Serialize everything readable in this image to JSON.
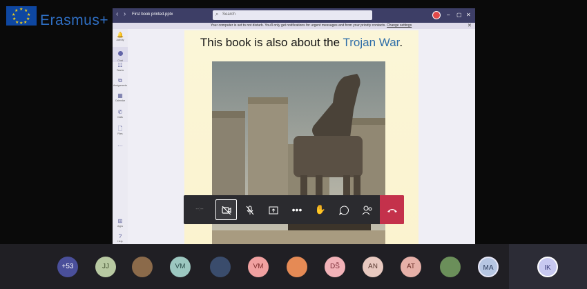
{
  "overlay": {
    "brand_text": "Erasmus+"
  },
  "window": {
    "title": "First book printed.pptx",
    "nav_back": "‹",
    "nav_forward": "›",
    "search_placeholder": "Search",
    "controls": {
      "minimize": "–",
      "maximize": "▢",
      "close": "✕"
    },
    "notification": {
      "text": "Your computer is set to not disturb. You'll only get notifications for urgent messages and from your priority contacts.",
      "link": "Change settings",
      "close": "✕"
    }
  },
  "left_rail": [
    {
      "name": "activity",
      "label": "Activity",
      "icon": "bell-icon",
      "glyph": "🔔"
    },
    {
      "name": "chat",
      "label": "Chat",
      "icon": "chat-icon",
      "glyph": ""
    },
    {
      "name": "teams",
      "label": "Teams",
      "icon": "teams-icon",
      "glyph": "☷"
    },
    {
      "name": "assignments",
      "label": "Assignments",
      "icon": "assignments-icon",
      "glyph": "⧉"
    },
    {
      "name": "calendar",
      "label": "Calendar",
      "icon": "calendar-icon",
      "glyph": "▦"
    },
    {
      "name": "calls",
      "label": "Calls",
      "icon": "phone-icon",
      "glyph": "✆"
    },
    {
      "name": "files",
      "label": "Files",
      "icon": "file-icon",
      "glyph": "🗋"
    },
    {
      "name": "more",
      "label": "",
      "icon": "more-icon",
      "glyph": "···"
    },
    {
      "name": "apps",
      "label": "Apps",
      "icon": "apps-icon",
      "glyph": "⊞"
    },
    {
      "name": "help",
      "label": "Help",
      "icon": "help-icon",
      "glyph": "?"
    }
  ],
  "slide": {
    "title_prefix": "This book is also about  the ",
    "title_highlight": "Trojan War",
    "title_suffix": "."
  },
  "meeting_controls": {
    "timer": "--:--",
    "camera_icon": "camera-off-icon",
    "mic_icon": "mic-off-icon",
    "share_icon": "share-icon",
    "more_icon": "more-icon",
    "raise_hand_icon": "raise-hand-icon",
    "chat_icon": "chat-icon",
    "participants_icon": "participants-icon",
    "hangup_icon": "hang-up-icon"
  },
  "participants": {
    "overflow_count": "+53",
    "avatars": [
      {
        "initials": "JJ",
        "bg": "#b8c9a2",
        "fg": "#3b4a2a"
      },
      {
        "initials": "",
        "bg": "#8b6a4a",
        "fg": "#fff",
        "photo": true
      },
      {
        "initials": "VM",
        "bg": "#9cc7c0",
        "fg": "#2b4d4a"
      },
      {
        "initials": "",
        "bg": "#3a4c6c",
        "fg": "#fff",
        "photo": true
      },
      {
        "initials": "VM",
        "bg": "#f0a0a0",
        "fg": "#7a2a2a"
      },
      {
        "initials": "",
        "bg": "#e58a55",
        "fg": "#fff",
        "photo": true
      },
      {
        "initials": "DŠ",
        "bg": "#f2b2b8",
        "fg": "#7a2a35"
      },
      {
        "initials": "AN",
        "bg": "#e8c9c0",
        "fg": "#5a3a32"
      },
      {
        "initials": "AT",
        "bg": "#e6b0a8",
        "fg": "#6a2f28"
      },
      {
        "initials": "",
        "bg": "#6b8f5a",
        "fg": "#fff",
        "photo": true
      },
      {
        "initials": "MA",
        "bg": "#b6c6e2",
        "fg": "#2a3a5a"
      }
    ],
    "active_speaker": {
      "initials": "IK",
      "bg": "#c7c8f0",
      "fg": "#3b3d7a"
    }
  },
  "colors": {
    "teams_purple": "#3d3e66",
    "hangup_red": "#c4314b",
    "slide_highlight": "#2f6ea8"
  }
}
